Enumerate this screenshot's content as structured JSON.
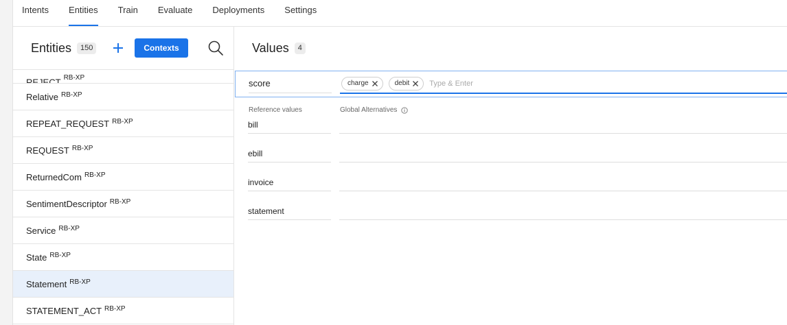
{
  "nav": {
    "tabs": [
      {
        "label": "Intents"
      },
      {
        "label": "Entities"
      },
      {
        "label": "Train"
      },
      {
        "label": "Evaluate"
      },
      {
        "label": "Deployments"
      },
      {
        "label": "Settings"
      }
    ],
    "active": "Entities"
  },
  "entities_panel": {
    "title": "Entities",
    "count": "150",
    "contexts_label": "Contexts",
    "items": [
      {
        "name": "REJECT",
        "tag": "RB-XP"
      },
      {
        "name": "Relative",
        "tag": "RB-XP"
      },
      {
        "name": "REPEAT_REQUEST",
        "tag": "RB-XP"
      },
      {
        "name": "REQUEST",
        "tag": "RB-XP"
      },
      {
        "name": "ReturnedCom",
        "tag": "RB-XP"
      },
      {
        "name": "SentimentDescriptor",
        "tag": "RB-XP"
      },
      {
        "name": "Service",
        "tag": "RB-XP"
      },
      {
        "name": "State",
        "tag": "RB-XP"
      },
      {
        "name": "Statement",
        "tag": "RB-XP"
      },
      {
        "name": "STATEMENT_ACT",
        "tag": "RB-XP"
      }
    ],
    "selected": "Statement"
  },
  "values_panel": {
    "title": "Values",
    "count": "4",
    "edit_row": {
      "value": "score",
      "chips": [
        "charge",
        "debit"
      ],
      "placeholder": "Type & Enter"
    },
    "col_reference": "Reference values",
    "col_alternatives": "Global Alternatives",
    "rows": [
      {
        "value": "bill"
      },
      {
        "value": "ebill"
      },
      {
        "value": "invoice"
      },
      {
        "value": "statement"
      }
    ]
  },
  "colors": {
    "accent": "#1a73e8",
    "selected_row": "#e8f0fb"
  }
}
